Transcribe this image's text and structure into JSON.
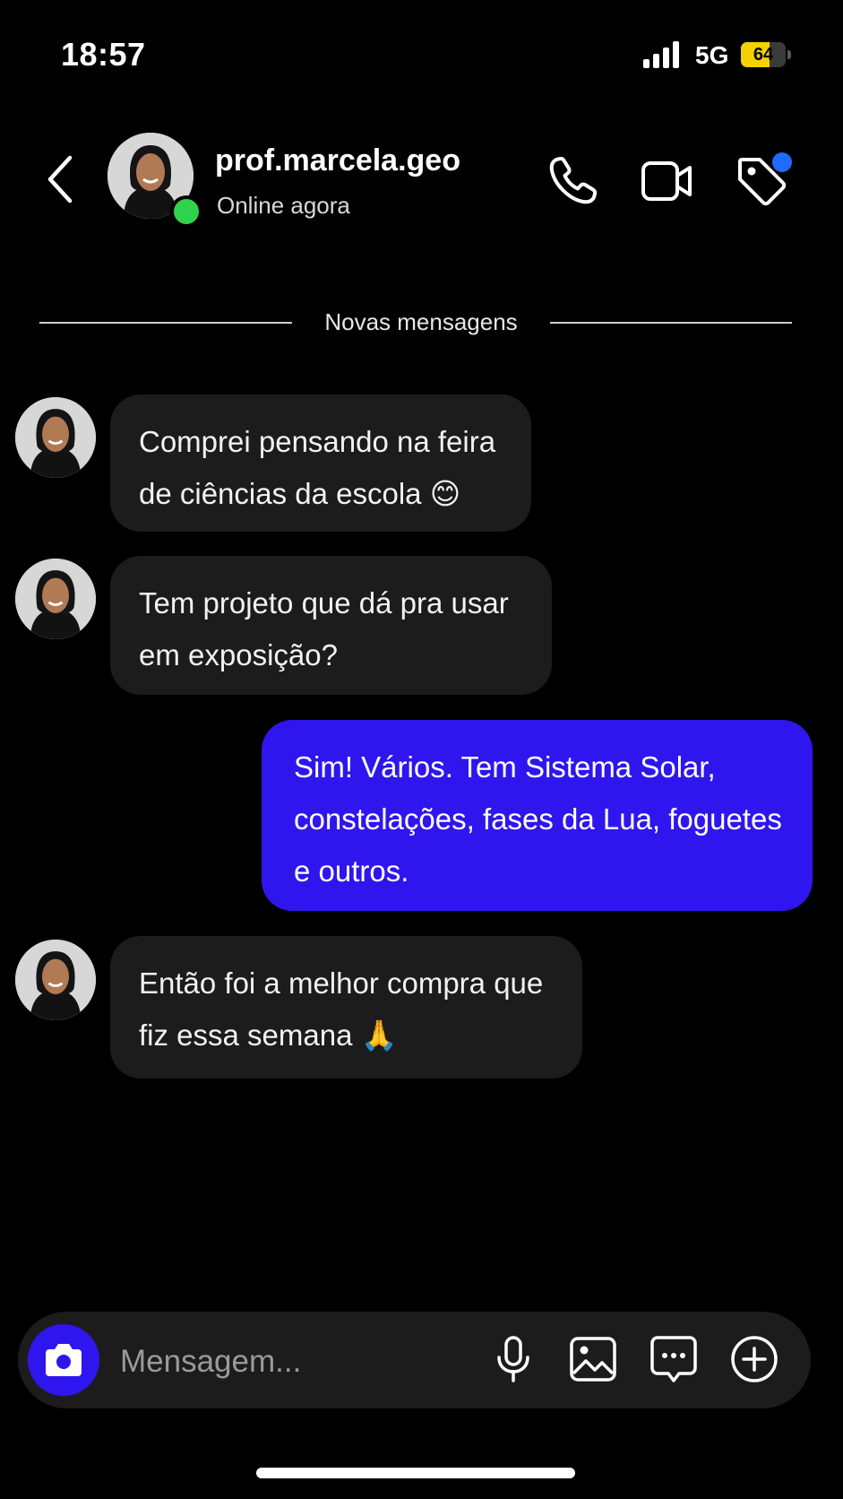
{
  "status_bar": {
    "time": "18:57",
    "network": "5G",
    "battery_text": "64",
    "battery_level": 0.64,
    "battery_color": "#f5d100"
  },
  "header": {
    "name": "prof.marcela.geo",
    "status": "Online agora",
    "online_color": "#2fd24c",
    "badge_color": "#1f6bff"
  },
  "divider": {
    "label": "Novas mensagens"
  },
  "messages": [
    {
      "side": "in",
      "lines": [
        "Comprei pensando na feira",
        "de ciências da escola 😊"
      ]
    },
    {
      "side": "in",
      "lines": [
        "Tem projeto que dá pra usar",
        "em exposição?"
      ]
    },
    {
      "side": "out",
      "lines": [
        "Sim! Vários. Tem Sistema Solar,",
        "constelações, fases da Lua, foguetes",
        "e outros."
      ]
    },
    {
      "side": "in",
      "lines": [
        "Então foi a melhor compra que",
        "fiz essa semana 🙏"
      ]
    }
  ],
  "composer": {
    "placeholder": "Mensagem..."
  },
  "colors": {
    "outgoing_bubble": "#2f16ee",
    "incoming_bubble": "#1c1c1d",
    "background": "#000000"
  },
  "icons": {
    "back": "chevron-left-icon",
    "call": "phone-icon",
    "video": "video-camera-icon",
    "tag": "tag-icon",
    "camera": "camera-icon",
    "mic": "microphone-icon",
    "gallery": "image-icon",
    "sticker": "chat-bubble-icon",
    "plus": "plus-circle-icon"
  }
}
